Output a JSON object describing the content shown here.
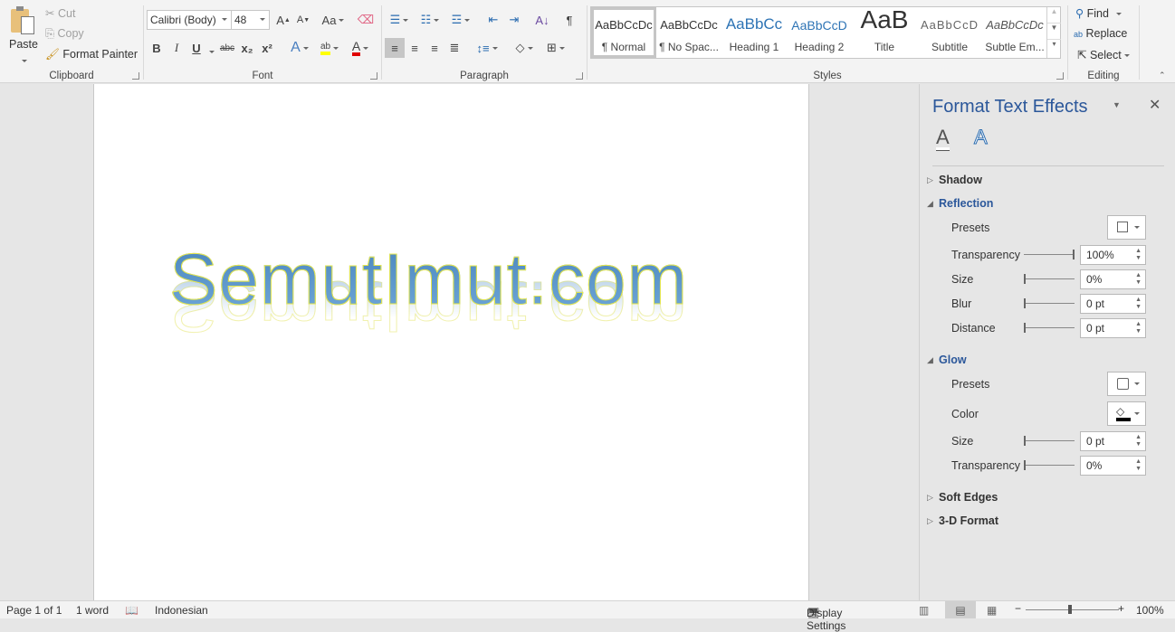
{
  "clipboard": {
    "paste": "Paste",
    "cut": "Cut",
    "copy": "Copy",
    "format_painter": "Format Painter",
    "label": "Clipboard"
  },
  "font": {
    "name": "Calibri (Body)",
    "size": "48",
    "label": "Font",
    "bold": "B",
    "italic": "I",
    "underline": "U",
    "strike": "abc",
    "sub": "x₂",
    "sup": "x²",
    "change_case": "Aa"
  },
  "paragraph": {
    "label": "Paragraph"
  },
  "styles": {
    "label": "Styles",
    "items": [
      {
        "preview": "AaBbCcDc",
        "name": "¶ Normal"
      },
      {
        "preview": "AaBbCcDc",
        "name": "¶ No Spac..."
      },
      {
        "preview": "AaBbCc",
        "name": "Heading 1"
      },
      {
        "preview": "AaBbCcD",
        "name": "Heading 2"
      },
      {
        "preview": "AaB",
        "name": "Title"
      },
      {
        "preview": "AaBbCcD",
        "name": "Subtitle"
      },
      {
        "preview": "AaBbCcDc",
        "name": "Subtle Em..."
      }
    ]
  },
  "editing": {
    "label": "Editing",
    "find": "Find",
    "replace": "Replace",
    "select": "Select"
  },
  "document": {
    "wordart_text": "SemutImut.com"
  },
  "pane": {
    "title": "Format Text Effects",
    "sections": {
      "shadow": "Shadow",
      "reflection": "Reflection",
      "glow": "Glow",
      "soft_edges": "Soft Edges",
      "three_d": "3-D Format"
    },
    "reflection": {
      "presets": "Presets",
      "transparency_label": "Transparency",
      "transparency": "100%",
      "size_label": "Size",
      "size": "0%",
      "blur_label": "Blur",
      "blur": "0 pt",
      "distance_label": "Distance",
      "distance": "0 pt"
    },
    "glow": {
      "presets": "Presets",
      "color_label": "Color",
      "size_label": "Size",
      "size": "0 pt",
      "transparency_label": "Transparency",
      "transparency": "0%"
    }
  },
  "status": {
    "page": "Page 1 of 1",
    "words": "1 word",
    "language": "Indonesian",
    "display_settings": "Display Settings",
    "zoom": "100%"
  }
}
